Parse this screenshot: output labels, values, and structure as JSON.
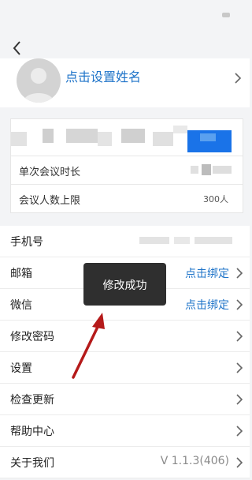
{
  "profile": {
    "name_prompt": "点击设置姓名"
  },
  "meeting": {
    "rows": [
      {
        "label": "单次会议时长",
        "value": ""
      },
      {
        "label": "会议人数上限",
        "value": "300人"
      }
    ]
  },
  "settings": {
    "phone": {
      "label": "手机号"
    },
    "email": {
      "label": "邮箱",
      "value": "点击绑定"
    },
    "wechat": {
      "label": "微信",
      "value": "点击绑定"
    },
    "change_password": {
      "label": "修改密码"
    },
    "settings": {
      "label": "设置"
    },
    "check_update": {
      "label": "检查更新"
    },
    "help_center": {
      "label": "帮助中心"
    },
    "about": {
      "label": "关于我们",
      "value": "V 1.1.3(406)"
    }
  },
  "toast": {
    "message": "修改成功"
  },
  "colors": {
    "accent": "#1f74c9",
    "annotation_arrow": "#b51a1a",
    "toast_bg": "#2f2f2f"
  },
  "icons": [
    "back-arrow-icon",
    "avatar-placeholder-icon",
    "chevron-right-icon"
  ]
}
